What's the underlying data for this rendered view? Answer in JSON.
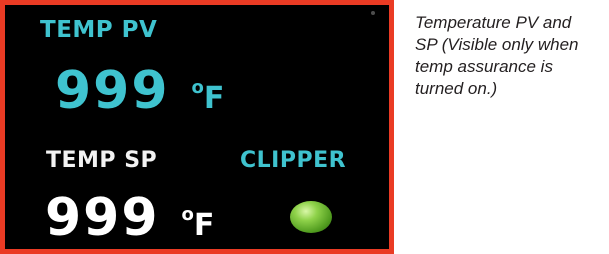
{
  "panel": {
    "pv_label": "TEMP PV",
    "pv_value": "999",
    "pv_unit_degree": "o",
    "pv_unit_letter": "F",
    "sp_label": "TEMP SP",
    "sp_value": "999",
    "sp_unit_degree": "o",
    "sp_unit_letter": "F",
    "clipper_label": "CLIPPER",
    "clipper_indicator_state": "on",
    "colors": {
      "background": "#000000",
      "border": "#ea3b24",
      "pv_text": "#3fc3cf",
      "sp_text": "#ffffff",
      "indicator": "#8fd24a"
    }
  },
  "caption": {
    "lines": [
      "Temperature PV and",
      "SP (Visible only when",
      "temp assurance is",
      "turned on.)"
    ]
  }
}
